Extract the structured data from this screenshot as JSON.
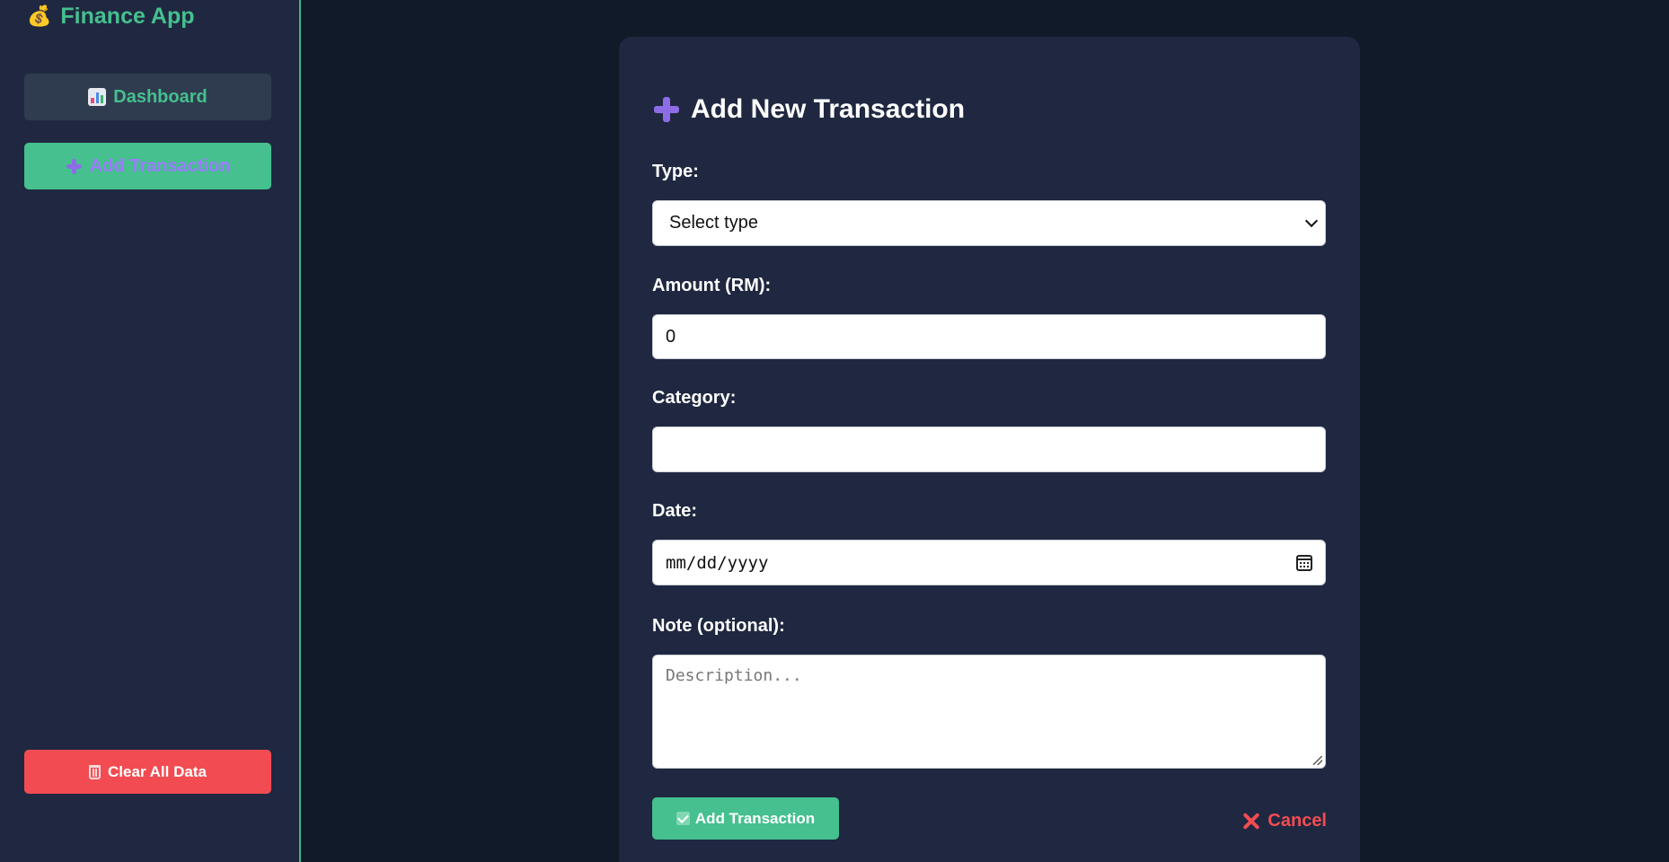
{
  "sidebar": {
    "brand": {
      "icon": "money-bag-icon",
      "title": "Finance App"
    },
    "nav": [
      {
        "icon": "bar-chart-icon",
        "label": "Dashboard"
      },
      {
        "icon": "plus-icon",
        "label": "Add Transaction",
        "active": true
      }
    ],
    "clear_button": {
      "icon": "trash-icon",
      "label": "Clear All Data"
    }
  },
  "form": {
    "title": "Add New Transaction",
    "title_icon": "plus-icon",
    "type": {
      "label": "Type:",
      "value": "Select type"
    },
    "amount": {
      "label": "Amount (RM):",
      "value": "0"
    },
    "category": {
      "label": "Category:",
      "value": ""
    },
    "date": {
      "label": "Date:",
      "placeholder": "mm/dd/yyyy"
    },
    "note": {
      "label": "Note (optional):",
      "placeholder": "Description..."
    },
    "submit_label": "Add Transaction",
    "cancel_label": "Cancel"
  },
  "colors": {
    "background": "#111a28",
    "panel": "#1f2840",
    "accent_green": "#45c08e",
    "danger_red": "#f24c52",
    "plus_purple": "#8e6ce8"
  }
}
